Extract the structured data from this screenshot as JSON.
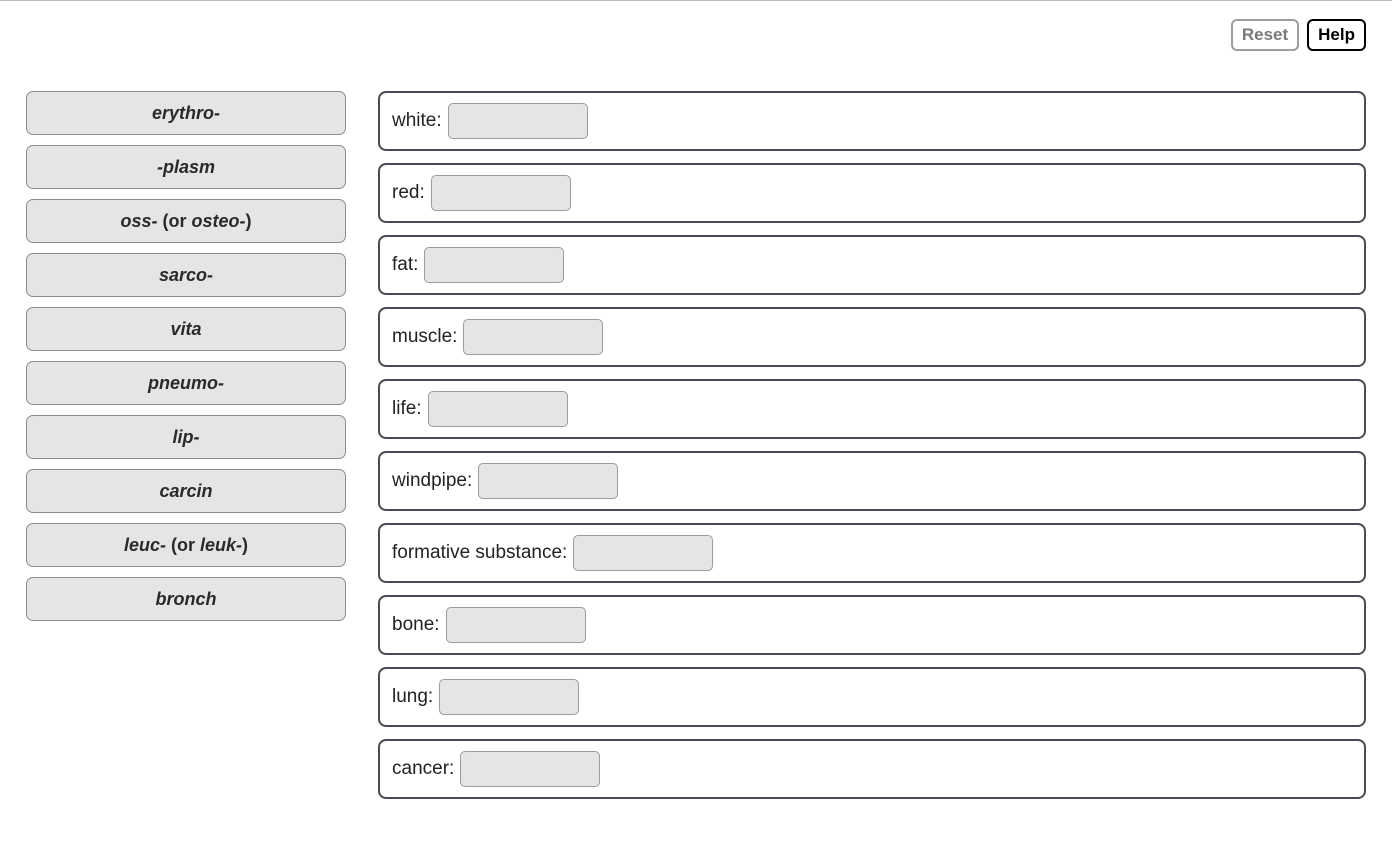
{
  "toolbar": {
    "reset_label": "Reset",
    "help_label": "Help"
  },
  "source_items": [
    {
      "text": "erythro-",
      "paren": ""
    },
    {
      "text": "-plasm",
      "paren": ""
    },
    {
      "text": "oss-",
      "paren": "(or osteo-)"
    },
    {
      "text": "sarco-",
      "paren": ""
    },
    {
      "text": "vita",
      "paren": ""
    },
    {
      "text": "pneumo-",
      "paren": ""
    },
    {
      "text": "lip-",
      "paren": ""
    },
    {
      "text": "carcin",
      "paren": ""
    },
    {
      "text": "leuc-",
      "paren": "(or leuk-)"
    },
    {
      "text": "bronch",
      "paren": ""
    }
  ],
  "target_items": [
    {
      "label": "white:"
    },
    {
      "label": "red:"
    },
    {
      "label": "fat:"
    },
    {
      "label": "muscle:"
    },
    {
      "label": "life:"
    },
    {
      "label": "windpipe:"
    },
    {
      "label": "formative substance:"
    },
    {
      "label": "bone:"
    },
    {
      "label": "lung:"
    },
    {
      "label": "cancer:"
    }
  ]
}
